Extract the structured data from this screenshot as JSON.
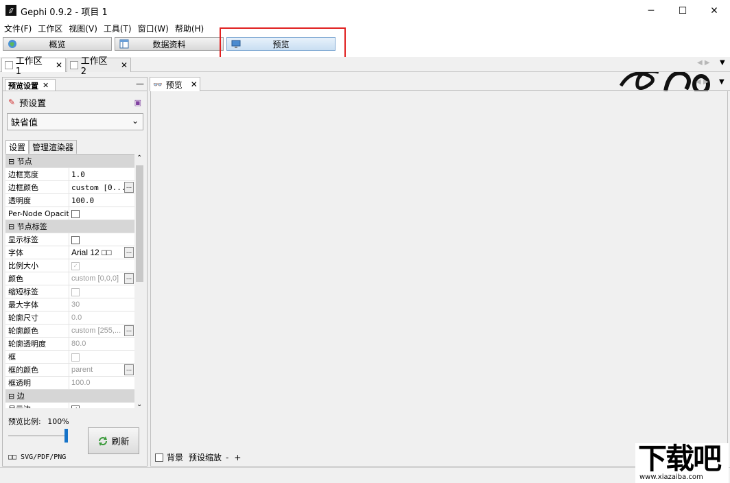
{
  "window": {
    "title": "Gephi 0.9.2 - 项目 1",
    "app_icon": "gephi-logo-icon",
    "controls": [
      "minimize-icon",
      "maximize-icon",
      "close-icon"
    ]
  },
  "menu": [
    "文件(F)",
    "工作区",
    "视图(V)",
    "工具(T)",
    "窗口(W)",
    "帮助(H)"
  ],
  "modes": {
    "overview": "概览",
    "data_lab": "数据资料",
    "preview": "预览",
    "active": "preview"
  },
  "workspaces": [
    {
      "label": "工作区 1",
      "active": true
    },
    {
      "label": "工作区 2",
      "active": false
    }
  ],
  "left_panel": {
    "tab_title": "预览设置",
    "preset_label": "预设置",
    "preset_value": "缺省值",
    "sub_tabs": [
      "设置",
      "管理渲染器"
    ],
    "properties": [
      {
        "type": "category",
        "name": "节点"
      },
      {
        "name": "边框宽度",
        "value": "1.0"
      },
      {
        "name": "边框颜色",
        "value": "custom [0...",
        "button": true
      },
      {
        "name": "透明度",
        "value": "100.0"
      },
      {
        "name": "Per-Node Opacity",
        "checkbox": "unchecked"
      },
      {
        "type": "category",
        "name": "节点标签"
      },
      {
        "name": "显示标签",
        "checkbox": "unchecked"
      },
      {
        "name": "字体",
        "value": "Arial 12 □□",
        "button": true,
        "sans": true
      },
      {
        "name": "比例大小",
        "checkbox": "checked-disabled"
      },
      {
        "name": "颜色",
        "value": "custom [0,0,0]",
        "button": true,
        "disabled": true
      },
      {
        "name": "缩短标签",
        "checkbox": "unchecked-disabled"
      },
      {
        "name": "最大字体",
        "value": "30",
        "disabled": true
      },
      {
        "name": "轮廓尺寸",
        "value": "0.0",
        "disabled": true
      },
      {
        "name": "轮廓颜色",
        "value": "custom [255,...",
        "button": true,
        "disabled": true
      },
      {
        "name": "轮廓透明度",
        "value": "80.0",
        "disabled": true
      },
      {
        "name": "框",
        "checkbox": "unchecked-disabled"
      },
      {
        "name": "框的颜色",
        "value": "parent",
        "button": true,
        "disabled": true
      },
      {
        "name": "框透明",
        "value": "100.0",
        "disabled": true
      },
      {
        "type": "category",
        "name": "边"
      },
      {
        "name": "显示边",
        "checkbox": "checked"
      }
    ],
    "ratio_label": "预览比例:",
    "ratio_value": "100%",
    "ratio_level": 1.0,
    "refresh_label": "刷新",
    "export_label": "□□ SVG/PDF/PNG"
  },
  "preview_panel": {
    "tab_title": "预览",
    "background_label": "背景",
    "zoom_label": "预设缩放",
    "zoom_minus": "-",
    "zoom_plus": "+"
  },
  "watermark": {
    "brand": "下载吧",
    "url": "www.xiazaiba.com"
  },
  "colors": {
    "highlight": "#e02020",
    "slider": "#1673c8",
    "category_bg": "#d6d6d6"
  }
}
